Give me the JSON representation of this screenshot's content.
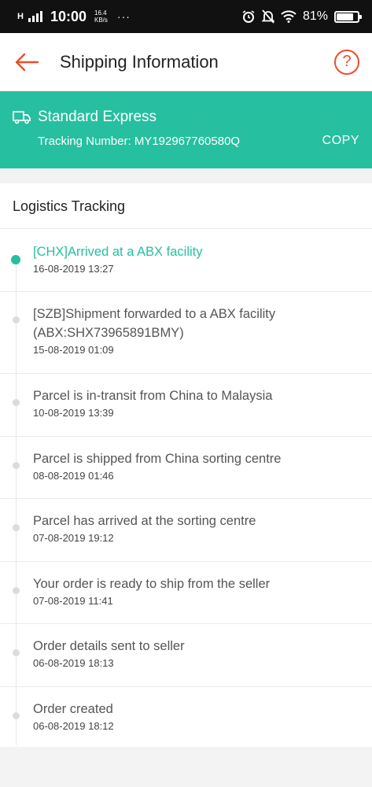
{
  "status_bar": {
    "network": "H",
    "time": "10:00",
    "speed_value": "16.4",
    "speed_unit": "KB/s",
    "more": "···",
    "battery": "81%",
    "battery_level": 0.81
  },
  "header": {
    "title": "Shipping Information",
    "help": "?"
  },
  "shipping": {
    "method": "Standard Express",
    "tracking_label": "Tracking Number: MY192967760580Q",
    "copy_label": "COPY"
  },
  "tracking": {
    "section_title": "Logistics Tracking",
    "events": [
      {
        "title": "[CHX]Arrived at a ABX facility",
        "time": "16-08-2019 13:27",
        "active": true
      },
      {
        "title": "[SZB]Shipment forwarded to a ABX facility (ABX:SHX73965891BMY)",
        "time": "15-08-2019 01:09",
        "active": false
      },
      {
        "title": "Parcel is in-transit from China to Malaysia",
        "time": "10-08-2019 13:39",
        "active": false
      },
      {
        "title": "Parcel is shipped from China sorting centre",
        "time": "08-08-2019 01:46",
        "active": false
      },
      {
        "title": "Parcel has arrived at the sorting centre",
        "time": "07-08-2019 19:12",
        "active": false
      },
      {
        "title": "Your order is ready to ship from the seller",
        "time": "07-08-2019 11:41",
        "active": false
      },
      {
        "title": "Order details sent to seller",
        "time": "06-08-2019 18:13",
        "active": false
      },
      {
        "title": "Order created",
        "time": "06-08-2019 18:12",
        "active": false
      }
    ]
  },
  "colors": {
    "accent": "#ee4d2d",
    "teal": "#26bfa0"
  }
}
